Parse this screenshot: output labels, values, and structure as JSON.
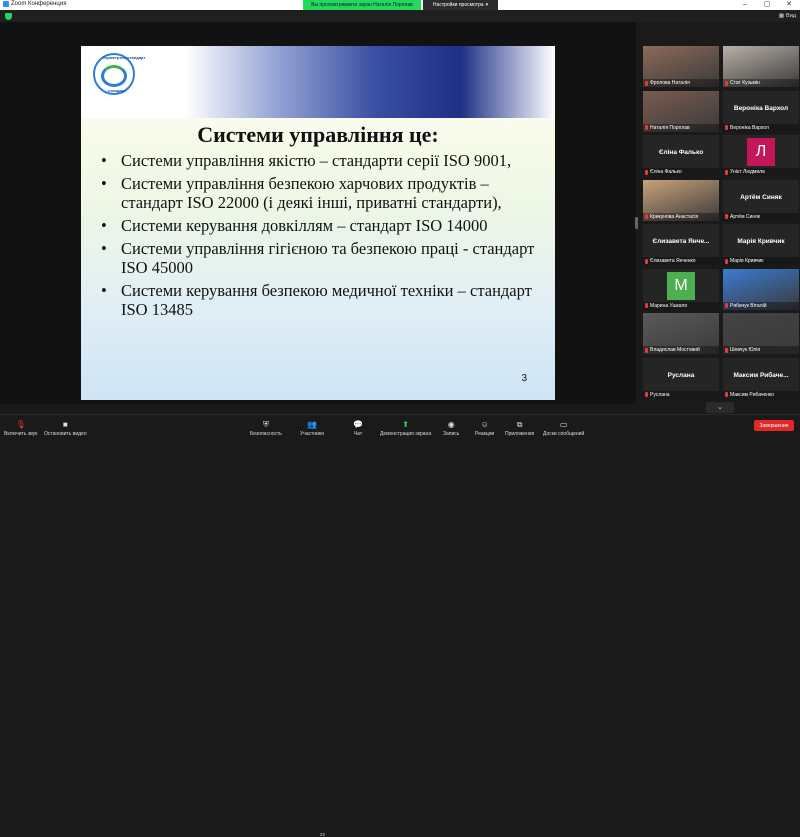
{
  "window": {
    "title": "Zoom Конференция",
    "share_banner": "Вы просматриваете экран Наталія Порплав",
    "view_options": "Настройки просмотра",
    "view_button": "Вид",
    "controls": [
      "–",
      "▢",
      "✕"
    ]
  },
  "slide": {
    "logo_top": "Укрметртестстандарт",
    "logo_bottom": "стандарт",
    "title": "Системи управління це:",
    "bullets": [
      "Системи управління якістю – стандарти серії ISO 9001,",
      "Системи управління безпекою харчових продуктів – стандарт ISO 22000 (і деякі інші, приватні стандарти),",
      "Системи керування довкіллям – стандарт ISO 14000",
      "Системи управління гігієною та безпекою праці - стандарт ISO 45000",
      "Системи керування безпекою медичної техніки – стандарт ISO 13485"
    ],
    "page_number": "3"
  },
  "participants": [
    {
      "name": "Фролова Наталія",
      "center": "",
      "video": true,
      "color": "#8c6a5a",
      "active": false
    },
    {
      "name": "Стат Кузьмін",
      "center": "",
      "video": true,
      "color": "#b8b0a6",
      "active": false
    },
    {
      "name": "Наталія Порплав",
      "center": "",
      "video": true,
      "color": "#7a5c50",
      "active": true
    },
    {
      "name": "Вероніка Вархол",
      "center": "Вероніка Вархол",
      "video": false,
      "active": false
    },
    {
      "name": "Єліна Фалько",
      "center": "Єліна Фалько",
      "video": false,
      "active": false
    },
    {
      "name": "Унієт Людмила",
      "center": "",
      "letter": "Л",
      "color": "#c2185b",
      "active": false
    },
    {
      "name": "Крикунова Анастасія",
      "center": "",
      "video": true,
      "color": "#c9a27a",
      "active": false
    },
    {
      "name": "Артём Синяк",
      "center": "Артём Синяк",
      "video": false,
      "active": false
    },
    {
      "name": "Єлизавета Янченко",
      "center": "Єлизавета Янче...",
      "video": false,
      "active": false
    },
    {
      "name": "Марія Кривчик",
      "center": "Марія Кривчик",
      "video": false,
      "active": false
    },
    {
      "name": "Марина Ушкало",
      "center": "",
      "letter": "М",
      "color": "#4caf50",
      "active": false
    },
    {
      "name": "Рибачук Віталій",
      "center": "",
      "video": true,
      "color": "#3b7bd1",
      "active": false
    },
    {
      "name": "Владислав Мостовий",
      "center": "",
      "video": true,
      "color": "#5a5a5a",
      "active": false
    },
    {
      "name": "Шевчук Юлія",
      "center": "",
      "video": true,
      "color": "#444444",
      "active": false
    },
    {
      "name": "Руслана",
      "center": "Руслана",
      "video": false,
      "active": false
    },
    {
      "name": "Максим Рибаченко",
      "center": "Максим Рибаче...",
      "video": false,
      "active": false
    }
  ],
  "toolbar": {
    "mic": "Включить звук",
    "video": "Остановить видео",
    "security": "Безопасность",
    "participants": "Участники",
    "participants_count": "22",
    "chat": "Чат",
    "share": "Демонстрация экрана",
    "record": "Запись",
    "reactions": "Реакции",
    "apps": "Приложения",
    "whiteboard": "Доски сообщений",
    "end": "Завершение"
  },
  "colors": {
    "accent_green": "#23d959",
    "end_red": "#e02828",
    "active_outline": "#9be54a"
  }
}
